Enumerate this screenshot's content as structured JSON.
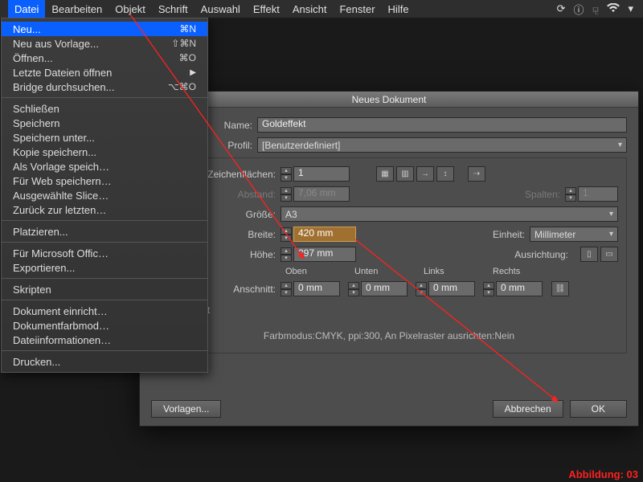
{
  "menubar": {
    "items": [
      "Datei",
      "Bearbeiten",
      "Objekt",
      "Schrift",
      "Auswahl",
      "Effekt",
      "Ansicht",
      "Fenster",
      "Hilfe"
    ],
    "active_index": 0
  },
  "dropdown": {
    "groups": [
      [
        {
          "label": "Neu...",
          "shortcut": "⌘N",
          "hl": true
        },
        {
          "label": "Neu aus Vorlage...",
          "shortcut": "⇧⌘N"
        },
        {
          "label": "Öffnen...",
          "shortcut": "⌘O"
        },
        {
          "label": "Letzte Dateien öffnen",
          "sub": true
        },
        {
          "label": "Bridge durchsuchen...",
          "shortcut": "⌥⌘O"
        }
      ],
      [
        {
          "label": "Schließen"
        },
        {
          "label": "Speichern"
        },
        {
          "label": "Speichern unter..."
        },
        {
          "label": "Kopie speichern..."
        },
        {
          "label": "Als Vorlage speich…"
        },
        {
          "label": "Für Web speichern…"
        },
        {
          "label": "Ausgewählte Slice…"
        },
        {
          "label": "Zurück zur letzten…"
        }
      ],
      [
        {
          "label": "Platzieren..."
        }
      ],
      [
        {
          "label": "Für Microsoft Offic…"
        },
        {
          "label": "Exportieren..."
        }
      ],
      [
        {
          "label": "Skripten"
        }
      ],
      [
        {
          "label": "Dokument einricht…"
        },
        {
          "label": "Dokumentfarbmod…"
        },
        {
          "label": "Dateiinformationen…"
        }
      ],
      [
        {
          "label": "Drucken..."
        }
      ]
    ]
  },
  "dialog": {
    "title": "Neues Dokument",
    "labels": {
      "name": "Name:",
      "profile": "Profil:",
      "artboards": "Anzahl an Zeichenflächen:",
      "spacing": "Abstand:",
      "columns": "Spalten:",
      "size": "Größe:",
      "width": "Breite:",
      "height": "Höhe:",
      "unit": "Einheit:",
      "orientation": "Ausrichtung:",
      "top": "Oben",
      "bottom": "Unten",
      "left": "Links",
      "right": "Rechts",
      "bleed": "Anschnitt:",
      "advanced": "Erweitert"
    },
    "fields": {
      "name": "Goldeffekt",
      "profile": "[Benutzerdefiniert]",
      "artboards": "1",
      "spacing": "7,06 mm",
      "columns": "1",
      "size": "A3",
      "width": "420 mm",
      "height": "297 mm",
      "unit": "Millimeter",
      "bleed_top": "0 mm",
      "bleed_bottom": "0 mm",
      "bleed_left": "0 mm",
      "bleed_right": "0 mm"
    },
    "summary": "Farbmodus:CMYK, ppi:300, An Pixelraster ausrichten:Nein",
    "buttons": {
      "templates": "Vorlagen...",
      "cancel": "Abbrechen",
      "ok": "OK"
    }
  },
  "caption": "Abbildung: 03"
}
